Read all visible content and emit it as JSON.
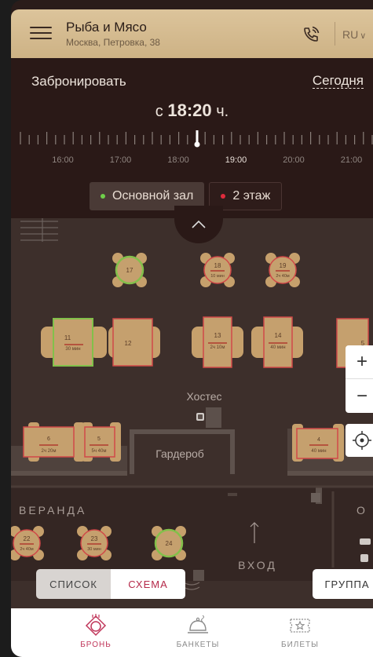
{
  "header": {
    "title": "Рыба и Мясо",
    "address": "Москва, Петровка, 38",
    "language": "RU"
  },
  "booking": {
    "label": "Забронировать",
    "date": "Сегодня",
    "time_prefix": "с",
    "time": "18:20",
    "time_suffix": "ч.",
    "timeline_hours": [
      "16:00",
      "17:00",
      "18:00",
      "19:00",
      "20:00",
      "21:00"
    ]
  },
  "zones": [
    {
      "label": "Основной зал",
      "dot_color": "#6fcf4a",
      "active": true
    },
    {
      "label": "2 этаж",
      "dot_color": "#e02b3c",
      "active": false
    }
  ],
  "floor": {
    "labels": {
      "hostess": "Хостес",
      "cloakroom": "Гардероб",
      "veranda": "ВЕРАНДА",
      "entrance": "ВХОД",
      "edge": "О"
    },
    "round_tables": [
      {
        "number": "17",
        "note": ""
      },
      {
        "number": "18",
        "note": "10 мин"
      },
      {
        "number": "19",
        "note": "2ч 40м"
      },
      {
        "number": "22",
        "note": "2ч 40м"
      },
      {
        "number": "23",
        "note": "30 мин"
      },
      {
        "number": "24",
        "note": ""
      }
    ],
    "rect_tables": [
      {
        "number": "11",
        "note": "30 мин"
      },
      {
        "number": "12",
        "note": ""
      },
      {
        "number": "13",
        "note": "2ч 10м"
      },
      {
        "number": "14",
        "note": "40 мин"
      },
      {
        "number": "6",
        "note": "2ч 20м"
      },
      {
        "number": "5",
        "note": "5ч 40м"
      },
      {
        "number": "4",
        "note": "40 мин"
      },
      {
        "number": "5",
        "note": ""
      }
    ]
  },
  "controls": {
    "zoom_in": "+",
    "zoom_out": "−",
    "list": "СПИСОК",
    "scheme": "СХЕМА",
    "group": "ГРУППА"
  },
  "nav": [
    {
      "label": "БРОНЬ",
      "icon": "dish-icon",
      "active": true
    },
    {
      "label": "БАНКЕТЫ",
      "icon": "cloche-icon",
      "active": false
    },
    {
      "label": "БИЛЕТЫ",
      "icon": "ticket-icon",
      "active": false
    }
  ],
  "colors": {
    "accent": "#c0365a",
    "free_table": "#7fbf3f",
    "busy_table": "#d04848",
    "table_wood": "#c8a472",
    "header_bg": "#d6bd93"
  }
}
